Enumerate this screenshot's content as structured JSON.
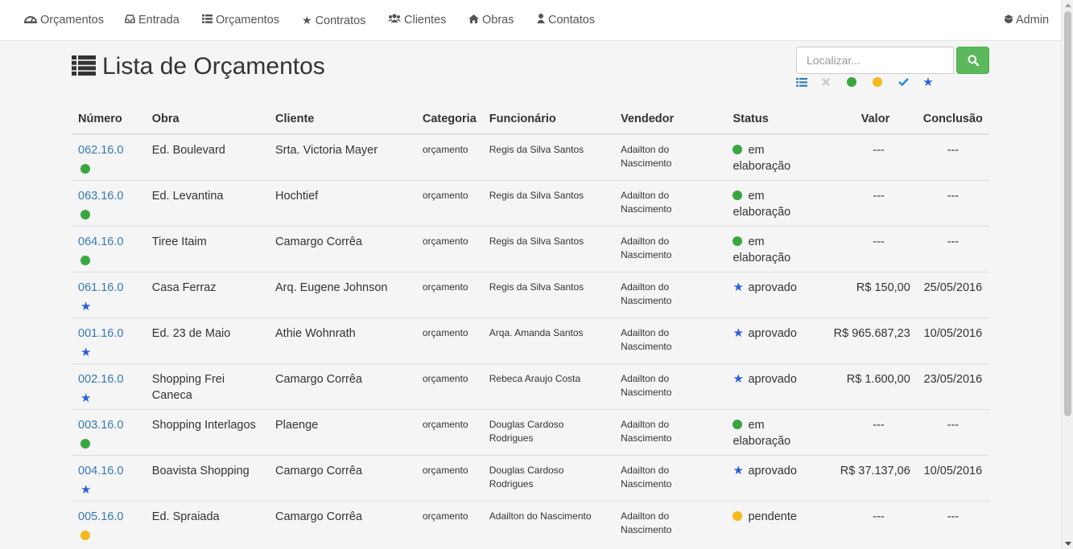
{
  "nav": {
    "brand": "Orçamentos",
    "items": [
      "Entrada",
      "Orçamentos",
      "Contratos",
      "Clientes",
      "Obras",
      "Contatos"
    ],
    "user": "Admin"
  },
  "page": {
    "title": "Lista de Orçamentos"
  },
  "search": {
    "placeholder": "Localizar..."
  },
  "colors": {
    "green": "#3aa642",
    "yellow": "#f6b91c",
    "blue": "#2a5fdb",
    "link": "#337ab7",
    "button": "#5cb85c"
  },
  "table": {
    "headers": [
      "Número",
      "Obra",
      "Cliente",
      "Categoria",
      "Funcionário",
      "Vendedor",
      "Status",
      "Valor",
      "Conclusão"
    ],
    "rows": [
      [
        "062.16.0",
        "Ed. Boulevard",
        "Srta. Victoria Mayer",
        "orçamento",
        "Regis da Silva Santos",
        "Adailton do Nascimento",
        "em elaboração",
        "---",
        "---"
      ],
      [
        "063.16.0",
        "Ed. Levantina",
        "Hochtief",
        "orçamento",
        "Regis da Silva Santos",
        "Adailton do Nascimento",
        "em elaboração",
        "---",
        "---"
      ],
      [
        "064.16.0",
        "Tiree Itaim",
        "Camargo Corrêa",
        "orçamento",
        "Regis da Silva Santos",
        "Adailton do Nascimento",
        "em elaboração",
        "---",
        "---"
      ],
      [
        "061.16.0",
        "Casa Ferraz",
        "Arq. Eugene Johnson",
        "orçamento",
        "Regis da Silva Santos",
        "Adailton do Nascimento",
        "aprovado",
        "R$ 150,00",
        "25/05/2016"
      ],
      [
        "001.16.0",
        "Ed. 23 de Maio",
        "Athie Wohnrath",
        "orçamento",
        "Arqa. Amanda Santos",
        "Adailton do Nascimento",
        "aprovado",
        "R$ 965.687,23",
        "10/05/2016"
      ],
      [
        "002.16.0",
        "Shopping Frei Caneca",
        "Camargo Corrêa",
        "orçamento",
        "Rebeca Araujo Costa",
        "Adailton do Nascimento",
        "aprovado",
        "R$ 1.600,00",
        "23/05/2016"
      ],
      [
        "003.16.0",
        "Shopping Interlagos",
        "Plaenge",
        "orçamento",
        "Douglas Cardoso Rodrigues",
        "Adailton do Nascimento",
        "em elaboração",
        "---",
        "---"
      ],
      [
        "004.16.0",
        "Boavista Shopping",
        "Camargo Corrêa",
        "orçamento",
        "Douglas Cardoso Rodrigues",
        "Adailton do Nascimento",
        "aprovado",
        "R$ 37.137,06",
        "10/05/2016"
      ],
      [
        "005.16.0",
        "Ed. Spraiada",
        "Camargo Corrêa",
        "orçamento",
        "Adailton do Nascimento",
        "Adailton do Nascimento",
        "pendente",
        "---",
        "---"
      ]
    ],
    "row_icons": [
      "green-dot",
      "green-dot",
      "green-dot",
      "star",
      "star",
      "star",
      "green-dot",
      "star",
      "yellow-dot"
    ]
  }
}
